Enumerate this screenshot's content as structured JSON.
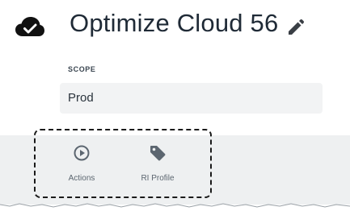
{
  "header": {
    "title": "Optimize Cloud 56",
    "status_icon": "cloud-check-icon",
    "edit_icon": "pencil-icon"
  },
  "scope": {
    "label": "SCOPE",
    "value": "Prod"
  },
  "tabs": [
    {
      "label": "Actions",
      "icon": "play-circle-icon"
    },
    {
      "label": "RI Profile",
      "icon": "tag-icon"
    }
  ],
  "colors": {
    "title_text": "#1f2a36",
    "field_background": "#f2f3f4",
    "tab_bar_background": "#eef0f1",
    "tab_icon": "#5c6670",
    "highlight_border": "#1a1a1a"
  }
}
